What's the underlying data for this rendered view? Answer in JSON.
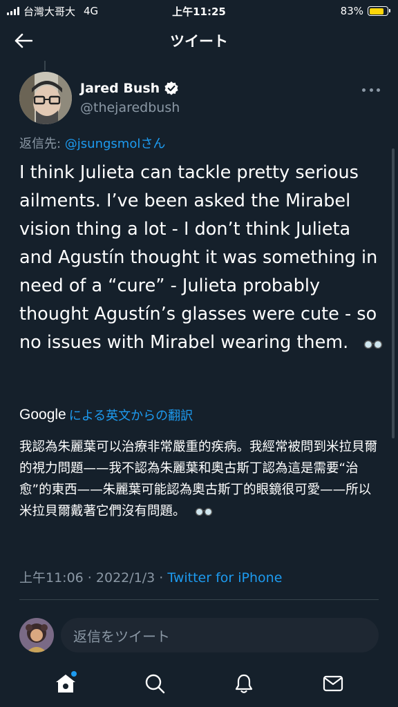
{
  "status_bar": {
    "carrier": "台灣大哥大",
    "network": "4G",
    "time": "上午11:25",
    "battery_percent": "83%",
    "battery_level": 0.83,
    "battery_color": "#ffd60a"
  },
  "header": {
    "title": "ツイート"
  },
  "tweet": {
    "author_name": "Jared Bush",
    "handle": "@thejaredbush",
    "reply_prefix": "返信先: ",
    "reply_mention": "@jsungsmolさん",
    "text": "I think Julieta can tackle pretty serious ailments. I’ve been asked the Mirabel vision thing a lot - I don’t think Julieta and Agustín thought it was something in need of a “cure” - Julieta probably thought Agustín’s glasses were cute - so no issues with Mirabel wearing them.",
    "translate_brand": "Google",
    "translate_label": "による英文からの翻訳",
    "translation": "我認為朱麗葉可以治療非常嚴重的疾病。我經常被問到米拉貝爾的視力問題——我不認為朱麗葉和奧古斯丁認為這是需要“治愈”的東西——朱麗葉可能認為奧古斯丁的眼鏡很可愛——所以米拉貝爾戴著它們沒有問題。",
    "time": "上午11:06",
    "separator": " · ",
    "date": "2022/1/3",
    "source": "Twitter for iPhone"
  },
  "reply_bar": {
    "placeholder": "返信をツイート"
  },
  "tabs": [
    {
      "name": "home",
      "icon": "home-icon",
      "has_notification": true
    },
    {
      "name": "search",
      "icon": "search-icon"
    },
    {
      "name": "notifications",
      "icon": "bell-icon"
    },
    {
      "name": "messages",
      "icon": "mail-icon"
    }
  ],
  "colors": {
    "background": "#15202b",
    "accent": "#1d9bf0",
    "secondary_text": "#8b98a5"
  }
}
